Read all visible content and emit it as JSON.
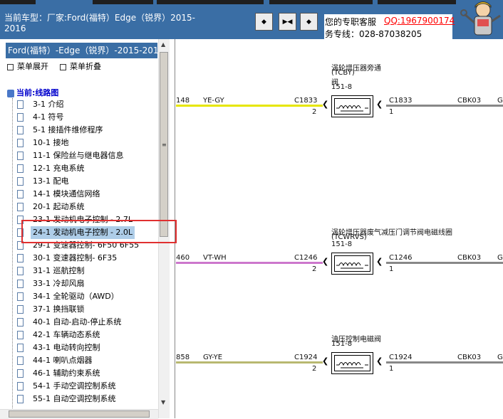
{
  "header": {
    "vehicle_line1": "当前车型：厂家:Ford(福特）Edge（锐界）2015-",
    "vehicle_line2": "2016",
    "nav_buttons": [
      "◆",
      "▶◀",
      "◆"
    ],
    "service_label": "您的专职客服",
    "service_qq": "QQ:1967900174",
    "service_hotline": "务专线：028-87038205"
  },
  "sidebar": {
    "title": "Ford(福特）-Edge（锐界）-2015-2016",
    "expand_label": "菜单展开",
    "collapse_label": "菜单折叠",
    "root": "当前:线路图",
    "items": [
      "3-1 介绍",
      "4-1 符号",
      "5-1 接插件维修程序",
      "10-1 接地",
      "11-1 保险丝与继电器信息",
      "12-1 充电系统",
      "13-1 配电",
      "14-1 模块通信网络",
      "20-1 起动系统",
      "23-1 发动机电子控制 - 2.7L",
      "24-1 发动机电子控制 - 2.0L",
      "29-1 变速器控制- 6F50 6F55",
      "30-1 变速器控制- 6F35",
      "31-1 巡航控制",
      "33-1 冷却风扇",
      "34-1 全轮驱动（AWD）",
      "37-1 换挡联锁",
      "40-1 自动-启动-停止系统",
      "42-1 车辆动态系统",
      "43-1 电动转向控制",
      "44-1 喇叭点烟器",
      "46-1 辅助约束系统",
      "54-1 手动空调控制系统",
      "55-1 自动空调控制系统"
    ],
    "selected_index": 10
  },
  "diagram": {
    "components": [
      {
        "name_lines": [
          "涡轮增压器旁通",
          "(TCBY)",
          "阀",
          "151-8"
        ],
        "left_wire_num": "148",
        "left_wire_color": "YE-GY",
        "connector": "C1833",
        "pin_left": "2",
        "right_connector": "C1833",
        "pin_right": "1",
        "right_circuit": "CBK03",
        "edge": "G",
        "wire_hex": "#e6e600"
      },
      {
        "name_lines": [
          "涡轮增压器废气减压门调节阀电磁线圈",
          "(TCWRVS)",
          "151-8"
        ],
        "left_wire_num": "460",
        "left_wire_color": "VT-WH",
        "connector": "C1246",
        "pin_left": "2",
        "right_connector": "C1246",
        "pin_right": "1",
        "right_circuit": "CBK03",
        "edge": "G",
        "wire_hex": "#cc77cc"
      },
      {
        "name_lines": [
          "油压控制电磁阀",
          "151-8"
        ],
        "left_wire_num": "858",
        "left_wire_color": "GY-YE",
        "connector": "C1924",
        "pin_left": "2",
        "right_connector": "C1924",
        "pin_right": "1",
        "right_circuit": "CBK03",
        "edge": "G",
        "wire_hex": "#b8b870"
      }
    ]
  },
  "colors": {
    "titlebar": "#3a6ea5",
    "selection": "#aecde8",
    "highlight_box": "#e03030",
    "ground_wire": "#888888",
    "qq_link": "#ff0000"
  }
}
